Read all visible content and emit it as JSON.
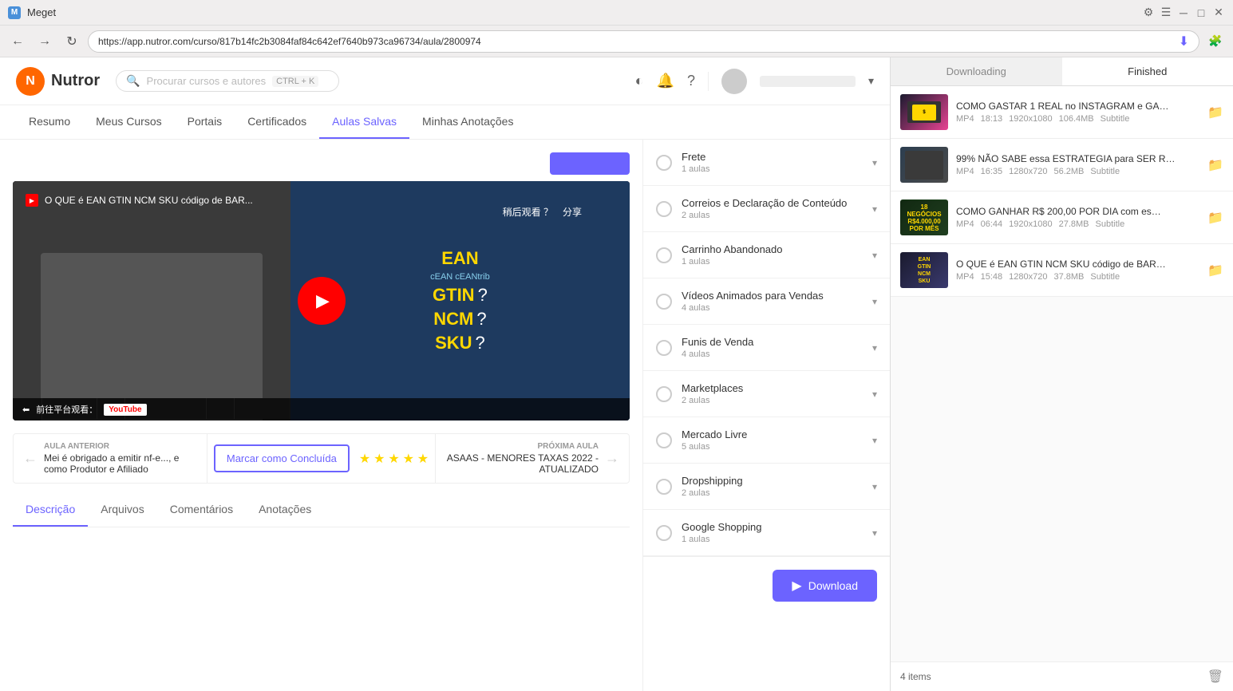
{
  "titleBar": {
    "appName": "Meget",
    "icon": "M"
  },
  "browserChrome": {
    "url": "https://app.nutror.com/curso/817b14fc2b3084faf84c642ef7640b973ca96734/aula/2800974"
  },
  "nutrorHeader": {
    "logoText": "Nutror",
    "searchPlaceholder": "Procurar cursos e autores",
    "searchShortcut": "CTRL + K"
  },
  "navItems": [
    {
      "label": "Resumo",
      "active": false
    },
    {
      "label": "Meus Cursos",
      "active": false
    },
    {
      "label": "Portais",
      "active": false
    },
    {
      "label": "Certificados",
      "active": false
    },
    {
      "label": "Aulas Salvas",
      "active": false
    },
    {
      "label": "Minhas Anotações",
      "active": false
    }
  ],
  "video": {
    "title": "O QUE é EAN GTIN NCM SKU código de BAR...",
    "textEAN": "EAN",
    "textcEAN": "cEAN cEANtrib",
    "textGTIN": "GTIN",
    "textNCM": "NCM",
    "textSKU": "SKU",
    "questionMark": "?"
  },
  "navigation": {
    "prevLabel": "AULA ANTERIOR",
    "prevTitle": "Mei é obrigado a emitir nf-e..., e como Produtor e Afiliado",
    "markComplete": "Marcar como Concluída",
    "nextLabel": "PRÓXIMA AULA",
    "nextTitle": "ASAAS - MENORES TAXAS 2022 - ATUALIZADO"
  },
  "contentTabs": [
    {
      "label": "Descrição",
      "active": true
    },
    {
      "label": "Arquivos",
      "active": false
    },
    {
      "label": "Comentários",
      "active": false
    },
    {
      "label": "Anotações",
      "active": false
    }
  ],
  "courseSections": [
    {
      "title": "Frete",
      "count": "1 aulas"
    },
    {
      "title": "Correios e Declaração de Conteúdo",
      "count": "2 aulas"
    },
    {
      "title": "Carrinho Abandonado",
      "count": "1 aulas"
    },
    {
      "title": "Vídeos Animados para Vendas",
      "count": "4 aulas"
    },
    {
      "title": "Funis de Venda",
      "count": "4 aulas"
    },
    {
      "title": "Marketplaces",
      "count": "2 aulas"
    },
    {
      "title": "Mercado Livre",
      "count": "5 aulas"
    },
    {
      "title": "Dropshipping",
      "count": "2 aulas"
    },
    {
      "title": "Google Shopping",
      "count": "1 aulas"
    }
  ],
  "downloadBtn": {
    "label": "Download"
  },
  "meget": {
    "tabs": [
      {
        "label": "Downloading",
        "active": false
      },
      {
        "label": "Finished",
        "active": true
      }
    ],
    "downloadItems": [
      {
        "title": "COMO GASTAR 1 REAL no INSTAGRAM e GA…",
        "format": "MP4",
        "duration": "18:13",
        "resolution": "1920x1080",
        "size": "106.4MB",
        "extra": "Subtitle",
        "thumbClass": "thumb-1"
      },
      {
        "title": "99% NÃO SABE essa ESTRATEGIA para SER R…",
        "format": "MP4",
        "duration": "16:35",
        "resolution": "1280x720",
        "size": "56.2MB",
        "extra": "Subtitle",
        "thumbClass": "thumb-2"
      },
      {
        "title": "COMO GANHAR R$ 200,00 POR DIA com es…",
        "format": "MP4",
        "duration": "06:44",
        "resolution": "1920x1080",
        "size": "27.8MB",
        "extra": "Subtitle",
        "thumbClass": "thumb-3"
      },
      {
        "title": "O QUE é EAN GTIN NCM SKU código de BAR…",
        "format": "MP4",
        "duration": "15:48",
        "resolution": "1280x720",
        "size": "37.8MB",
        "extra": "Subtitle",
        "thumbClass": "thumb-4"
      }
    ],
    "itemsCount": "4 items"
  }
}
